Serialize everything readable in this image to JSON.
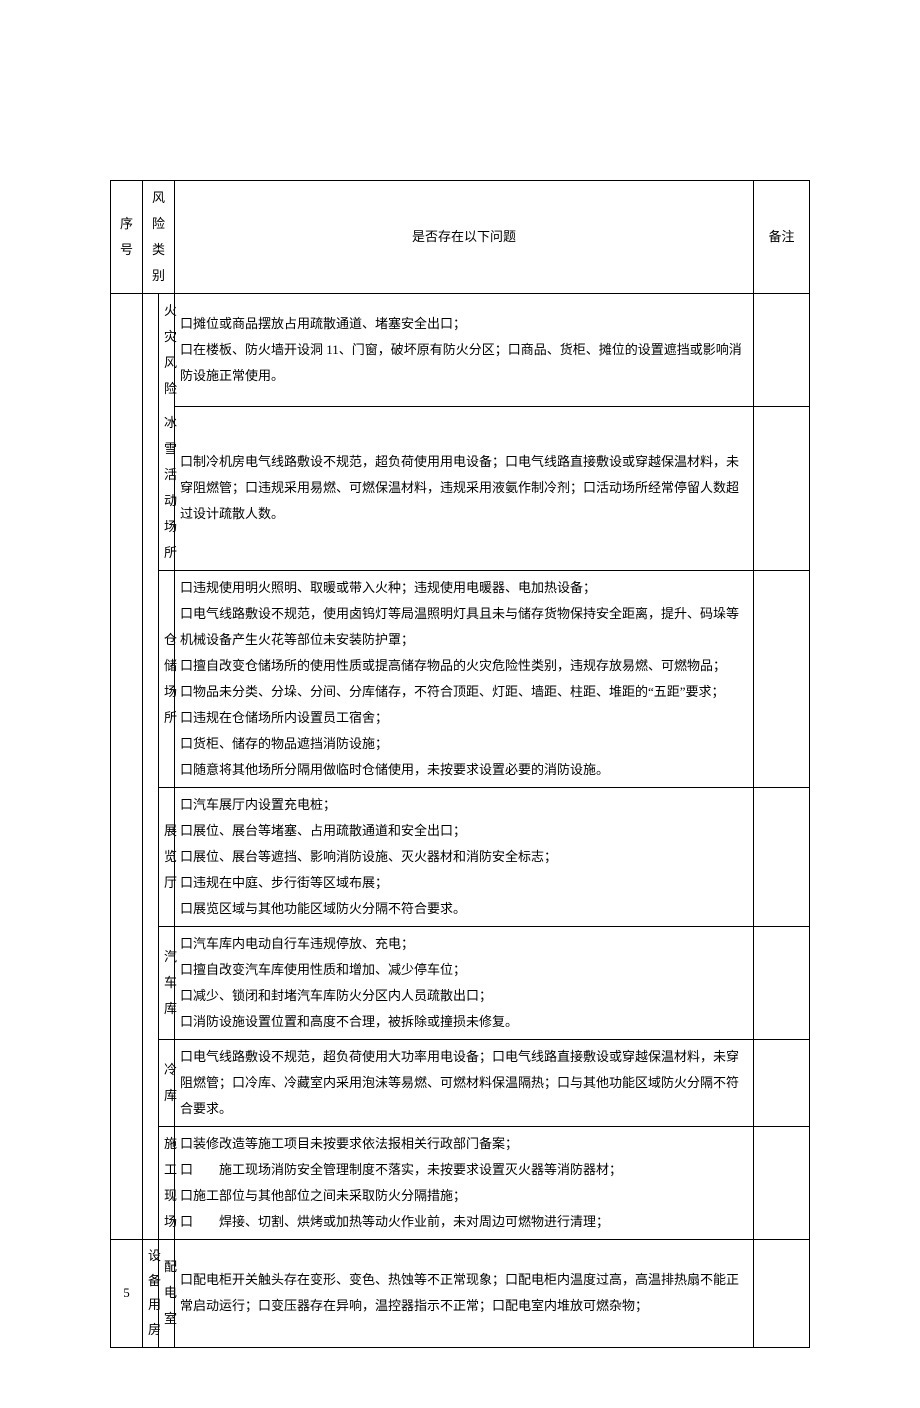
{
  "headers": {
    "xuhao": "序号",
    "category": "风险类别",
    "issues": "是否存在以下问题",
    "beizhu": "备注"
  },
  "rows": [
    {
      "xuhao": "",
      "cat1": "",
      "cat2": "火灾风险",
      "issues": "口摊位或商品摆放占用疏散通道、堵塞安全出口；\n口在楼板、防火墙开设洞 11、门窗，破坏原有防火分区；口商品、货柜、摊位的设置遮挡或影响消防设施正常使用。",
      "beizhu": ""
    },
    {
      "cat2": "冰雪活动场所",
      "issues": "口制冷机房电气线路敷设不规范，超负荷使用用电设备；口电气线路直接敷设或穿越保温材料，未穿阻燃管；口违规采用易燃、可燃保温材料，违规采用液氨作制冷剂；口活动场所经常停留人数超过设计疏散人数。",
      "beizhu": ""
    },
    {
      "cat2": "仓储场所",
      "issues": "口违规使用明火照明、取暖或带入火种；违规使用电暖器、电加热设备；\n口电气线路敷设不规范，使用卤钨灯等局温照明灯具且未与储存货物保持安全距离，提升、码垛等机械设备产生火花等部位未安装防护罩；\n口擅自改变仓储场所的使用性质或提高储存物品的火灾危险性类别，违规存放易燃、可燃物品；\n口物品未分类、分垛、分间、分库储存，不符合顶距、灯距、墙距、柱距、堆距的“五距”要求；\n口违规在仓储场所内设置员工宿舍；\n口货柜、储存的物品遮挡消防设施；\n口随意将其他场所分隔用做临时仓储使用，未按要求设置必要的消防设施。",
      "beizhu": ""
    },
    {
      "cat2": "展览厅",
      "issues": "口汽车展厅内设置充电桩；\n口展位、展台等堵塞、占用疏散通道和安全出口；\n口展位、展台等遮挡、影响消防设施、灭火器材和消防安全标志；\n口违规在中庭、步行街等区域布展；\n口展览区域与其他功能区域防火分隔不符合要求。",
      "beizhu": ""
    },
    {
      "cat2": "汽车库",
      "issues": "口汽车库内电动自行车违规停放、充电；\n口擅自改变汽车库使用性质和增加、减少停车位；\n口减少、锁闭和封堵汽车库防火分区内人员疏散出口；\n口消防设施设置位置和高度不合理，被拆除或撞损未修复。",
      "beizhu": ""
    },
    {
      "cat2": "冷库",
      "issues": "口电气线路敷设不规范，超负荷使用大功率用电设备；口电气线路直接敷设或穿越保温材料，未穿阻燃管；口冷库、冷藏室内采用泡沫等易燃、可燃材料保温隔热；口与其他功能区域防火分隔不符合要求。",
      "beizhu": ""
    },
    {
      "cat2": "施工现场",
      "issues": "口装修改造等施工项目未按要求依法报相关行政部门备案；\n口　　施工现场消防安全管理制度不落实，未按要求设置灭火器等消防器材；\n口施工部位与其他部位之间未采取防火分隔措施；\n口　　焊接、切割、烘烤或加热等动火作业前，未对周边可燃物进行清理；",
      "beizhu": ""
    },
    {
      "xuhao": "5",
      "cat1_lines": [
        "设",
        "备",
        "用",
        "房"
      ],
      "cat2": "配电室",
      "issues": "口配电柜开关触头存在变形、变色、热蚀等不正常现象；口配电柜内温度过高，高温排热扇不能正常启动运行；口变压器存在异响，温控器指示不正常；口配电室内堆放可燃杂物；",
      "beizhu": ""
    }
  ]
}
